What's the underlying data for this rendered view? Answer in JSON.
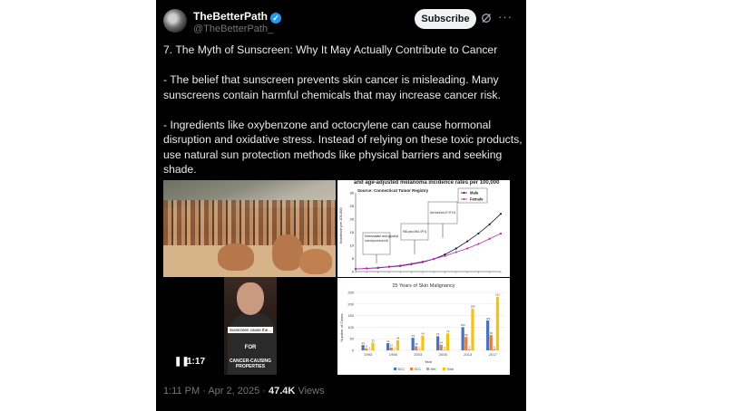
{
  "post": {
    "author_name": "TheBetterPath",
    "author_handle": "@TheBetterPath_",
    "subscribe_label": "Subscribe",
    "more_glyph": "···",
    "paragraphs": [
      "7. The Myth of Sunscreen: Why It May Actually Contribute to Cancer",
      "- The belief that sunscreen prevents skin cancer is misleading. Many sunscreens contain harmful chemicals that may increase cancer risk.",
      "- Ingredients like oxybenzone and octocrylene can cause hormonal disruption and oxidative stress. Instead of relying on these toxic products, use natural sun protection methods like physical barriers and seeking shade."
    ],
    "footer": {
      "time": "1:11 PM",
      "date": "Apr 2, 2025",
      "views_count": "47.4K",
      "views_label": "Views"
    }
  },
  "media": {
    "video": {
      "duration": "1:17",
      "caption_small": "Sunscreen cause the...",
      "caption_for": "FOR",
      "caption_bottom": "CANCER-CAUSING PROPERTIES"
    },
    "chart1": {
      "title": "and age-adjusted melanoma incidence rates per 100,000",
      "source": "Source: Connecticut Tumor Registry",
      "ylabel": "Incidence per 100,000",
      "annotations": [
        "Homosalate and glyceryl paraminobenzoate (late 1940s)",
        "PABA (early 1960s, SPF 8)",
        "Higher Erythemal Blocks (1977, SPF 30-15)"
      ]
    },
    "chart2": {
      "title": "25 Years of Skin Malignancy",
      "xlabel": "Year",
      "ylabel": "Number of Cases"
    }
  },
  "chart_data": [
    {
      "type": "line",
      "title": "and age-adjusted melanoma incidence rates per 100,000",
      "ylabel": "Incidence per 100,000",
      "x": [
        1935,
        1940,
        1945,
        1950,
        1955,
        1960,
        1965,
        1970,
        1975,
        1980,
        1985,
        1990,
        1995,
        2000
      ],
      "ylim": [
        0,
        30
      ],
      "yticks": [
        0,
        5,
        10,
        15,
        20,
        25,
        30
      ],
      "series": [
        {
          "name": "Male",
          "color": "#1a1a3a",
          "values": [
            1.0,
            1.2,
            1.4,
            1.8,
            2.1,
            2.8,
            3.6,
            4.8,
            6.5,
            8.8,
            11.5,
            14.5,
            18.0,
            22.0
          ]
        },
        {
          "name": "Female",
          "color": "#c020c0",
          "values": [
            1.0,
            1.2,
            1.5,
            1.9,
            2.3,
            3.0,
            3.8,
            4.8,
            6.0,
            7.4,
            8.8,
            10.5,
            12.5,
            14.5
          ]
        }
      ]
    },
    {
      "type": "bar",
      "title": "25 Years of Skin Malignancy",
      "xlabel": "Year",
      "ylabel": "Number of Cases",
      "categories": [
        "1993",
        "1998",
        "2003",
        "2008",
        "2013",
        "2017"
      ],
      "ylim": [
        0,
        250
      ],
      "yticks": [
        0,
        50,
        100,
        150,
        200,
        250
      ],
      "series": [
        {
          "name": "BCC",
          "color": "#4472c4",
          "values": [
            23,
            31,
            54,
            61,
            100,
            129
          ]
        },
        {
          "name": "SCC",
          "color": "#ed7d31",
          "values": [
            9,
            12,
            18,
            24,
            58,
            66
          ]
        },
        {
          "name": "MM",
          "color": "#a5a5a5",
          "values": [
            1,
            1,
            2,
            3,
            5,
            6
          ]
        },
        {
          "name": "Total",
          "color": "#ffc000",
          "values": [
            33,
            44,
            64,
            73,
            180,
            231
          ]
        }
      ]
    }
  ]
}
